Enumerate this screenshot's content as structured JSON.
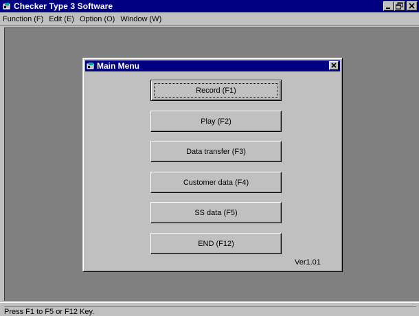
{
  "window": {
    "title": "Checker Type 3 Software",
    "icon": "app-icon",
    "controls": [
      "minimize-icon",
      "maximize-icon",
      "close-icon"
    ]
  },
  "menubar": {
    "items": [
      {
        "label": "Function (F)"
      },
      {
        "label": "Edit (E)"
      },
      {
        "label": "Option (O)"
      },
      {
        "label": "Window (W)"
      }
    ]
  },
  "dialog": {
    "title": "Main Menu",
    "icon": "dialog-icon",
    "buttons": [
      {
        "label": "Record (F1)",
        "default": true
      },
      {
        "label": "Play (F2)"
      },
      {
        "label": "Data transfer (F3)"
      },
      {
        "label": "Customer data (F4)"
      },
      {
        "label": "SS data (F5)"
      },
      {
        "label": "END (F12)"
      }
    ],
    "version": "Ver1.01"
  },
  "statusbar": {
    "text": "Press F1 to F5 or F12 Key."
  },
  "colors": {
    "face": "#c0c0c0",
    "titlebar": "#000080",
    "workspace": "#808080"
  }
}
